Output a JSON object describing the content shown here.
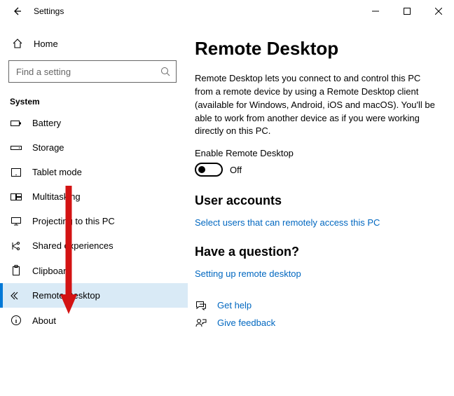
{
  "titlebar": {
    "title": "Settings"
  },
  "home_label": "Home",
  "search": {
    "placeholder": "Find a setting"
  },
  "category_label": "System",
  "sidebar": {
    "items": [
      {
        "label": "Battery"
      },
      {
        "label": "Storage"
      },
      {
        "label": "Tablet mode"
      },
      {
        "label": "Multitasking"
      },
      {
        "label": "Projecting to this PC"
      },
      {
        "label": "Shared experiences"
      },
      {
        "label": "Clipboard"
      },
      {
        "label": "Remote Desktop"
      },
      {
        "label": "About"
      }
    ]
  },
  "main": {
    "heading": "Remote Desktop",
    "description": "Remote Desktop lets you connect to and control this PC from a remote device by using a Remote Desktop client (available for Windows, Android, iOS and macOS). You'll be able to work from another device as if you were working directly on this PC.",
    "toggle_label": "Enable Remote Desktop",
    "toggle_state": "Off",
    "user_accounts_heading": "User accounts",
    "user_accounts_link": "Select users that can remotely access this PC",
    "question_heading": "Have a question?",
    "question_link": "Setting up remote desktop",
    "get_help": "Get help",
    "give_feedback": "Give feedback"
  }
}
